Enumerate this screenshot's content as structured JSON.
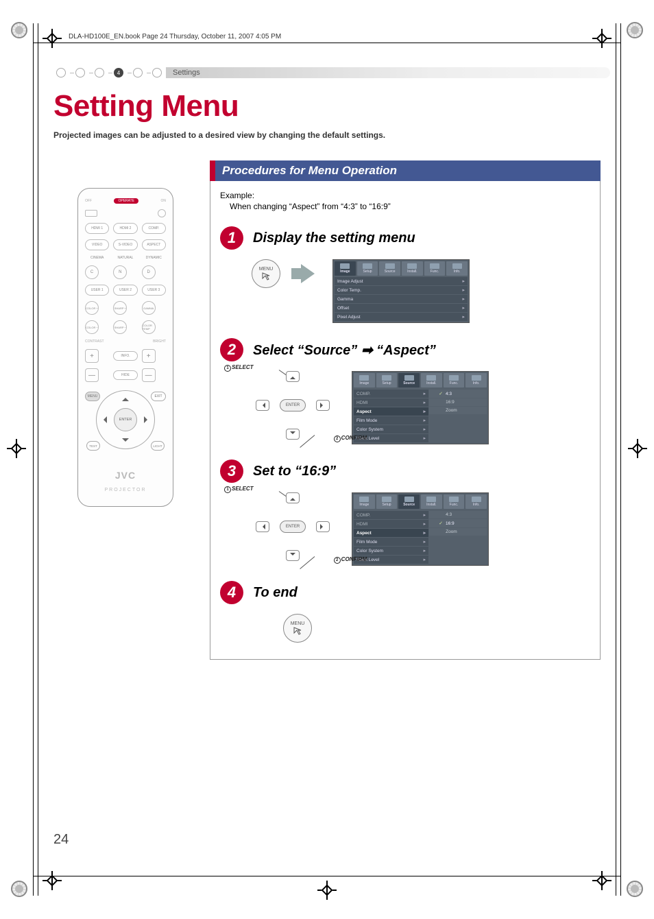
{
  "page": {
    "running_header": "DLA-HD100E_EN.book  Page 24  Thursday, October 11, 2007  4:05 PM",
    "number": "24"
  },
  "breadcrumb": {
    "active_index": "4",
    "label": "Settings"
  },
  "title": "Setting Menu",
  "subtitle": "Projected images can be adjusted to a desired view by changing the default settings.",
  "remote": {
    "operate": {
      "off": "OFF",
      "label": "OPERATE",
      "on": "ON"
    },
    "row1": [
      "HDMI 1",
      "HDMI 2",
      "COMP."
    ],
    "row2": [
      "VIDEO",
      "S-VIDEO",
      "ASPECT"
    ],
    "row2_labels": [
      "CINEMA",
      "NATURAL",
      "DYNAMIC"
    ],
    "row2_circles": [
      "C",
      "N",
      "D"
    ],
    "row3": [
      "USER 1",
      "USER 2",
      "USER 3"
    ],
    "row4": [
      "COLOR +",
      "SHARP +",
      "GAMMA"
    ],
    "row5": [
      "COLOR −",
      "SHARP −",
      "COLOR TEMP"
    ],
    "contrast_label": "CONTRAST",
    "bright_label": "BRIGHT",
    "info_label": "INFO.",
    "hide_label": "HIDE",
    "plus": "+",
    "minus": "—",
    "dpad": {
      "menu": "MENU",
      "exit": "EXIT",
      "enter": "ENTER",
      "test": "TEST",
      "light": "LIGHT"
    },
    "brand": "JVC",
    "brand_sub": "PROJECTOR"
  },
  "proc": {
    "header": "Procedures for Menu Operation",
    "example_label": "Example:",
    "example_text": "When changing “Aspect” from “4:3” to “16:9”",
    "steps": {
      "s1": {
        "num": "1",
        "title": "Display the setting menu"
      },
      "s2": {
        "num": "2",
        "title_a": "Select “Source” ",
        "title_b": " “Aspect”",
        "select": "SELECT",
        "confirm": "CONFIRM",
        "circ1": "1",
        "circ2": "2"
      },
      "s3": {
        "num": "3",
        "title": "Set to “16:9”",
        "select": "SELECT",
        "confirm": "CONFIRM",
        "circ1": "1",
        "circ2": "2"
      },
      "s4": {
        "num": "4",
        "title": "To end"
      }
    },
    "menu_btn_label": "MENU",
    "enter_btn_label": "ENTER"
  },
  "osd": {
    "tabs": [
      "Image",
      "Setup",
      "Source",
      "Install.",
      "Func.",
      "Info."
    ],
    "image_rows": [
      "Image Adjust",
      "Color Temp.",
      "Gamma",
      "Offset",
      "Pixel Adjust"
    ],
    "source_rows": {
      "comp": "COMP.",
      "hdmi": "HDMI",
      "aspect": "Aspect",
      "film": "Film Mode",
      "colorsys": "Color System",
      "black": "Black Level"
    },
    "aspect_opts": {
      "a43": "4:3",
      "a169": "16:9",
      "zoom": "Zoom"
    },
    "check": "✓",
    "chev": "▸"
  }
}
